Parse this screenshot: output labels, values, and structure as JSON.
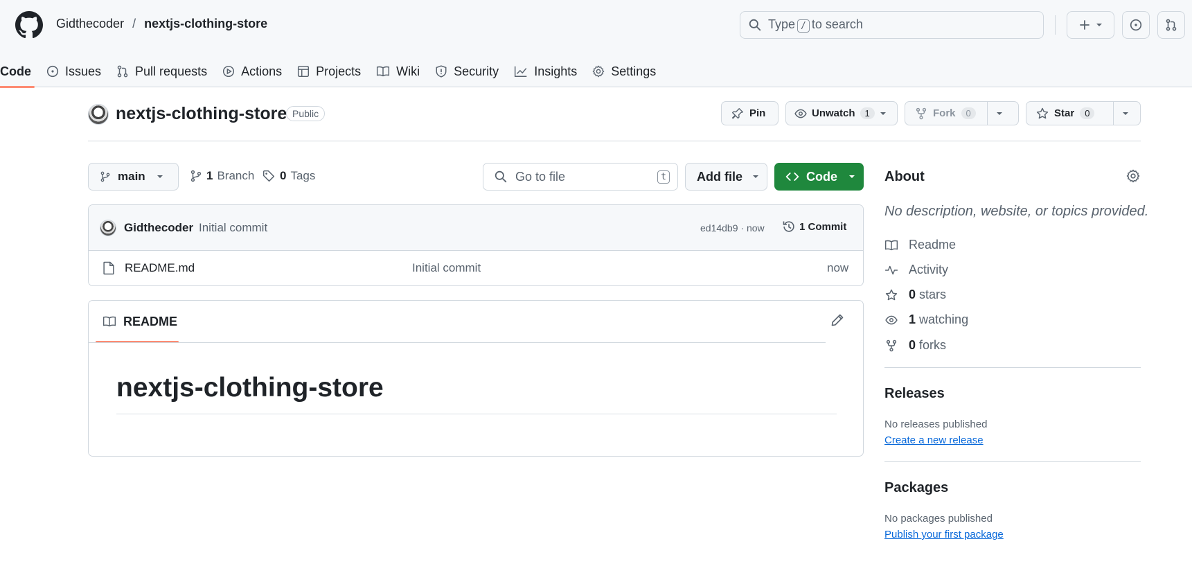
{
  "header": {
    "owner": "Gidthecoder",
    "separator": "/",
    "repo": "nextjs-clothing-store",
    "search_pre": "Type",
    "search_key": "/",
    "search_post": "to search"
  },
  "tabs": [
    {
      "label": "Code",
      "icon": "code-icon"
    },
    {
      "label": "Issues",
      "icon": "issue-icon"
    },
    {
      "label": "Pull requests",
      "icon": "pull-request-icon"
    },
    {
      "label": "Actions",
      "icon": "play-icon"
    },
    {
      "label": "Projects",
      "icon": "table-icon"
    },
    {
      "label": "Wiki",
      "icon": "book-icon"
    },
    {
      "label": "Security",
      "icon": "shield-icon"
    },
    {
      "label": "Insights",
      "icon": "graph-icon"
    },
    {
      "label": "Settings",
      "icon": "gear-icon"
    }
  ],
  "repo_header": {
    "name": "nextjs-clothing-store",
    "visibility": "Public",
    "pin": "Pin",
    "unwatch": "Unwatch",
    "watch_count": "1",
    "fork": "Fork",
    "fork_count": "0",
    "star": "Star",
    "star_count": "0"
  },
  "toolbar": {
    "branch": "main",
    "branch_count": "1",
    "branch_label": "Branch",
    "tag_count": "0",
    "tag_label": "Tags",
    "goto_placeholder": "Go to file",
    "goto_key": "t",
    "add_file": "Add file",
    "code": "Code"
  },
  "commit": {
    "author": "Gidthecoder",
    "message": "Initial commit",
    "hash_time": "ed14db9 · now",
    "commits": "1 Commit"
  },
  "files": [
    {
      "name": "README.md",
      "message": "Initial commit",
      "time": "now"
    }
  ],
  "readme": {
    "tab": "README",
    "heading": "nextjs-clothing-store"
  },
  "about": {
    "title": "About",
    "description": "No description, website, or topics provided.",
    "readme": "Readme",
    "activity": "Activity",
    "stars_count": "0",
    "stars_label": "stars",
    "watching_count": "1",
    "watching_label": "watching",
    "forks_count": "0",
    "forks_label": "forks"
  },
  "releases": {
    "title": "Releases",
    "none": "No releases published",
    "link": "Create a new release"
  },
  "packages": {
    "title": "Packages",
    "none": "No packages published",
    "link": "Publish your first package"
  },
  "colors": {
    "accent": "#fd8c73",
    "primary_button": "#1f883d",
    "link": "#0969da"
  }
}
